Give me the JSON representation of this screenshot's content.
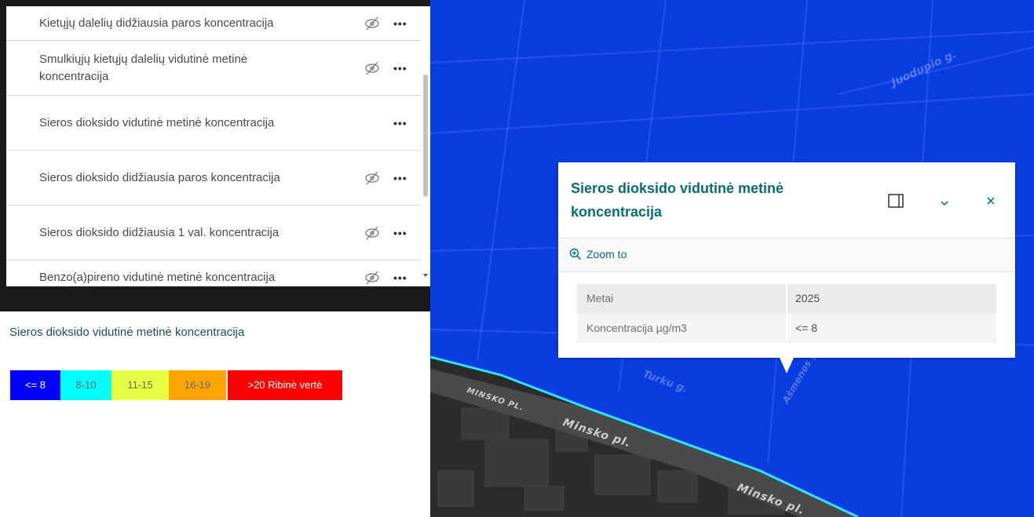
{
  "layer_list": {
    "items": [
      {
        "title": "Kietųjų dalelių didžiausia paros koncentracija",
        "visibility": "hidden"
      },
      {
        "title": "Smulkiųjų kietųjų dalelių vidutinė metinė koncentracija",
        "visibility": "hidden"
      },
      {
        "title": "Sieros dioksido vidutinė metinė koncentracija",
        "visibility": "visible"
      },
      {
        "title": "Sieros dioksido didžiausia paros koncentracija",
        "visibility": "hidden"
      },
      {
        "title": "Sieros dioksido didžiausia 1 val. koncentracija",
        "visibility": "hidden"
      },
      {
        "title": "Benzo(a)pireno vidutinė metinė koncentracija",
        "visibility": "hidden"
      }
    ],
    "more_label": "•••"
  },
  "legend": {
    "title": "Sieros dioksido vidutinė metinė koncentracija",
    "classes": [
      {
        "label": "<= 8",
        "color": "#0000ff",
        "text_color": "#ffffff"
      },
      {
        "label": "8-10",
        "color": "#00ffff",
        "text_color": "#6a6a6a"
      },
      {
        "label": "11-15",
        "color": "#e6ff45",
        "text_color": "#6a6a6a"
      },
      {
        "label": "16-19",
        "color": "#ffa500",
        "text_color": "#6a6a6a"
      },
      {
        "label": ">20 Ribinė vertė",
        "color": "#ff0000",
        "text_color": "#ffffff"
      }
    ]
  },
  "popup": {
    "title": "Sieros dioksido vidutinė metinė koncentracija",
    "zoom_label": "Zoom to",
    "attributes": [
      {
        "key": "Metai",
        "value": "2025"
      },
      {
        "key": "Koncentracija µg/m3",
        "value": "<= 8"
      }
    ]
  },
  "map": {
    "street_labels": [
      "Juodupio g.",
      "Turku g.",
      "Ašmenos g.",
      "MINSKO PL.",
      "Minsko pl.",
      "Minsko pl."
    ],
    "area_color": "#0a3de0",
    "boundary_color": "#2ee6ff"
  },
  "colors": {
    "accent": "#0b6b71"
  }
}
